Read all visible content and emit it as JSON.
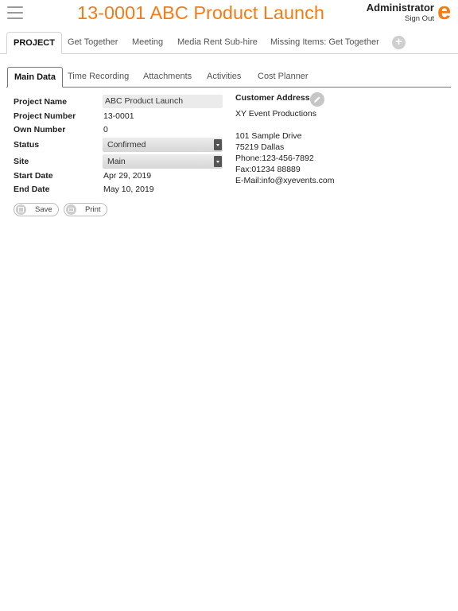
{
  "header": {
    "title": "13-0001 ABC Product Launch",
    "user": "Administrator",
    "sign_out": "Sign Out",
    "logo_letter": "e",
    "accent_color": "#f07c1a"
  },
  "main_tabs": {
    "items": [
      "PROJECT",
      "Get Together",
      "Meeting",
      "Media Rent Sub-hire",
      "Missing Items: Get Together"
    ],
    "active": "PROJECT",
    "add_label": "+"
  },
  "sub_tabs": {
    "items": [
      "Main Data",
      "Time Recording",
      "Attachments",
      "Activities",
      "Cost Planner"
    ],
    "active": "Main Data"
  },
  "form": {
    "project_name": {
      "label": "Project Name",
      "value": "ABC Product Launch"
    },
    "project_number": {
      "label": "Project Number",
      "value": "13-0001"
    },
    "own_number": {
      "label": "Own Number",
      "value": "0"
    },
    "status": {
      "label": "Status",
      "value": "Confirmed"
    },
    "site": {
      "label": "Site",
      "value": "Main"
    },
    "start_date": {
      "label": "Start Date",
      "value": "Apr 29, 2019"
    },
    "end_date": {
      "label": "End Date",
      "value": "May 10, 2019"
    }
  },
  "actions": {
    "save": "Save",
    "print": "Print"
  },
  "customer": {
    "title": "Customer Address",
    "company": "XY Event Productions",
    "street": "101 Sample Drive",
    "city": "75219 Dallas",
    "phone": "Phone:123-456-7892",
    "fax": "Fax:01234 88889",
    "email": "E-Mail:info@xyevents.com"
  },
  "icons": {
    "menu": "hamburger-menu-icon",
    "logo": "e-logo-icon",
    "add": "plus-icon",
    "edit": "pencil-icon",
    "save": "save-disk-icon",
    "print": "printer-icon",
    "dropdown": "dropdown-arrow-icon"
  }
}
